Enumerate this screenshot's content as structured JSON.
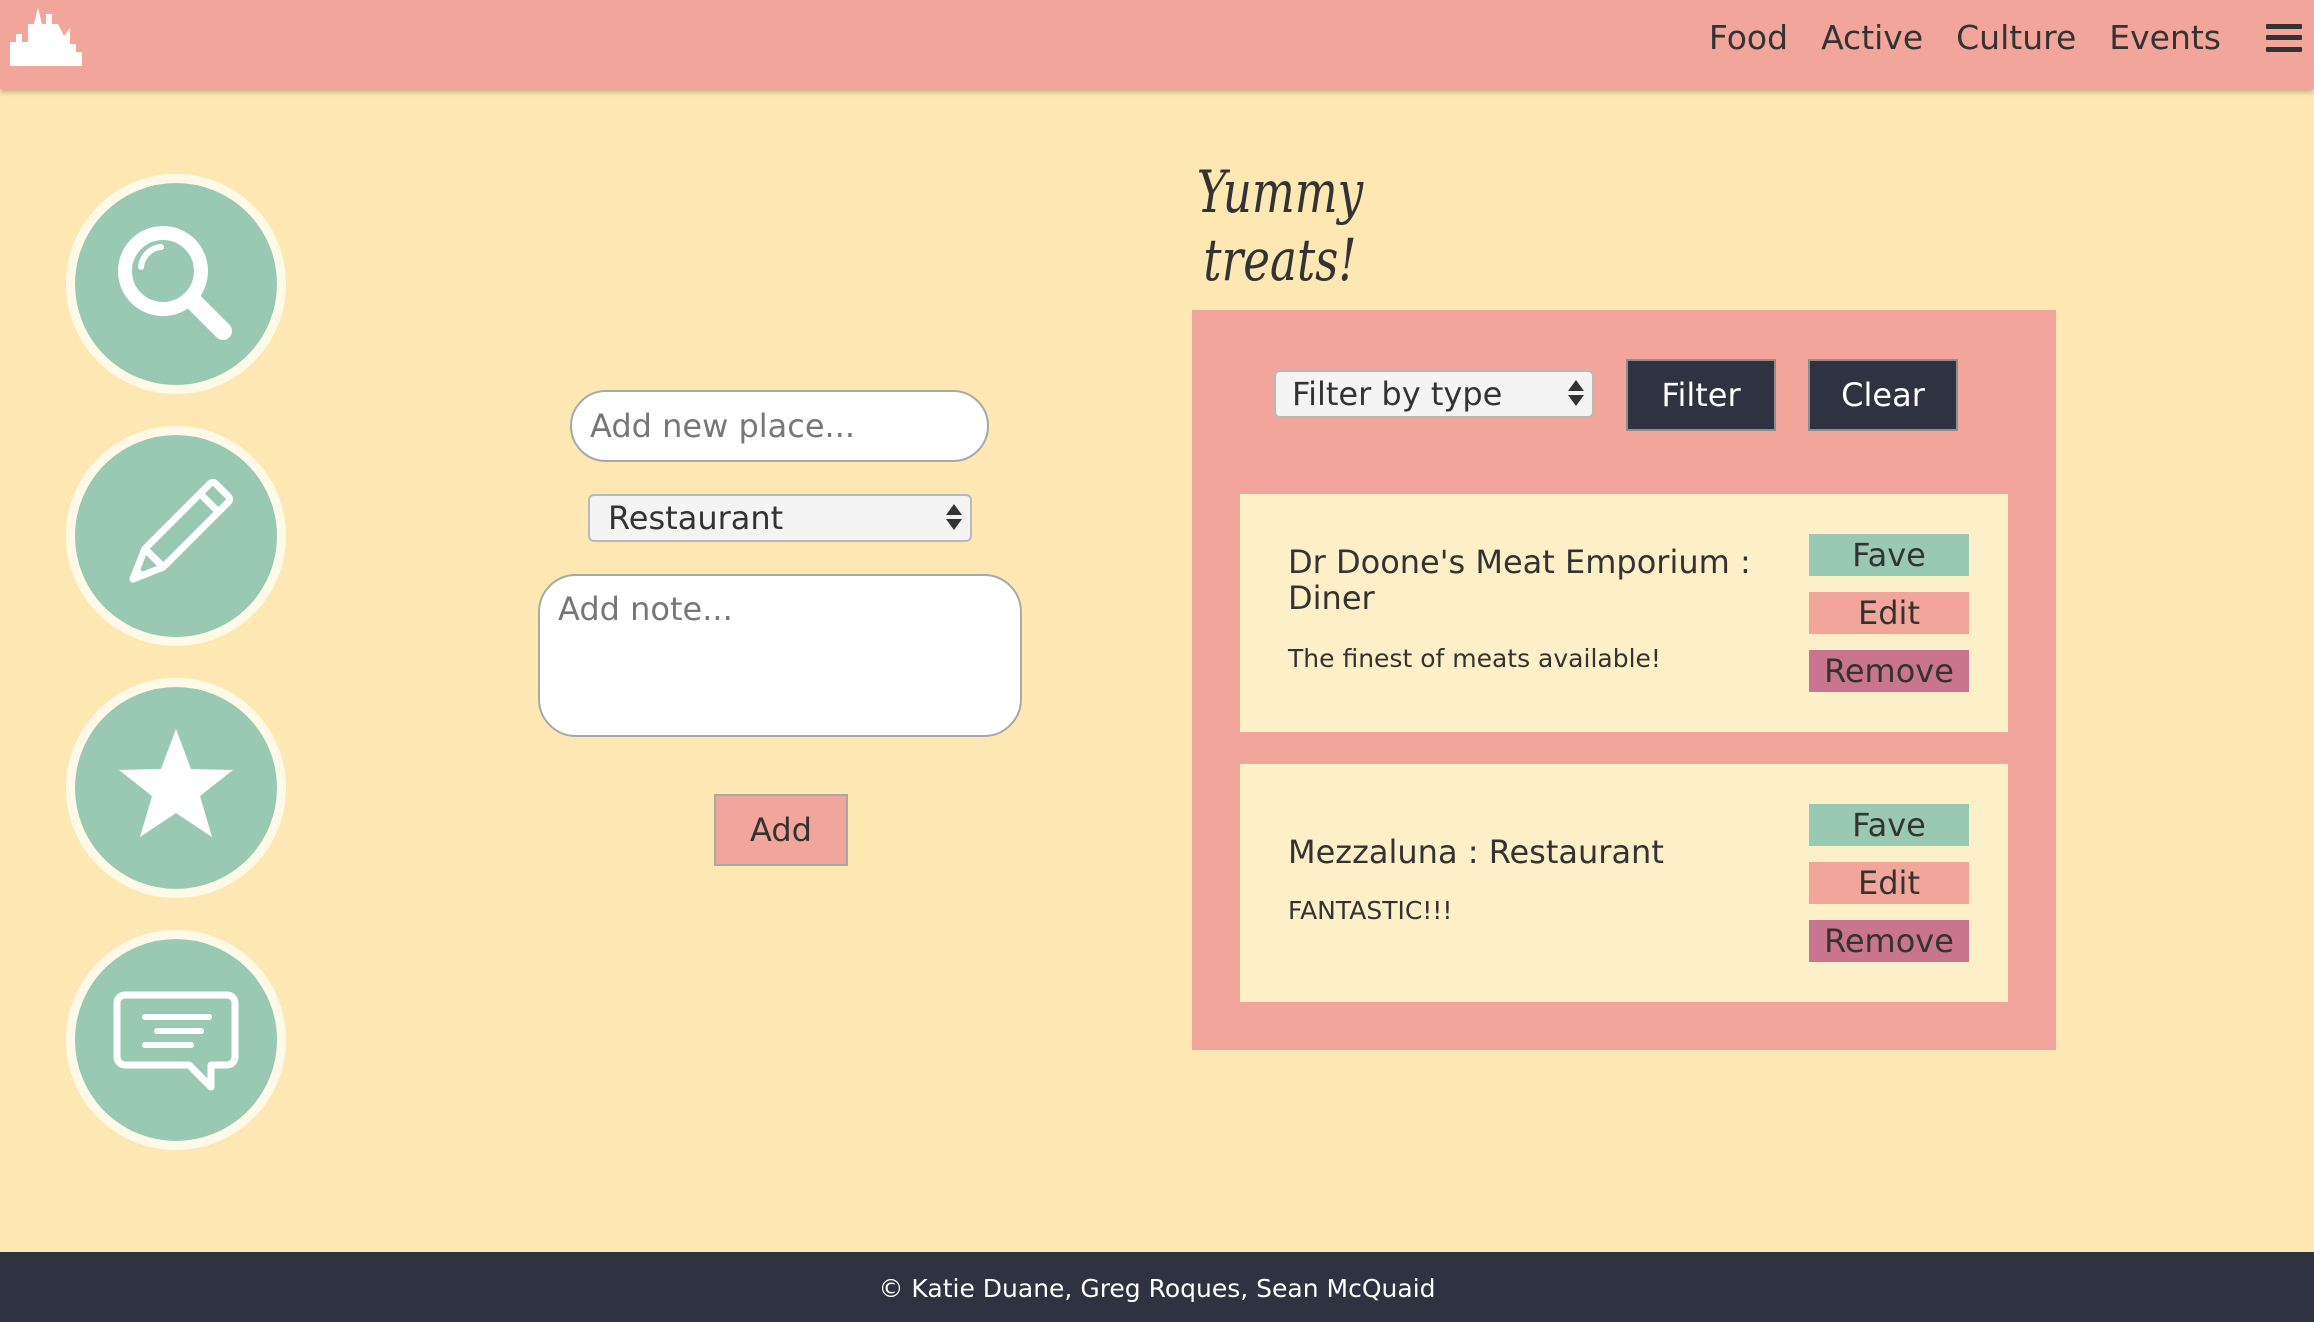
{
  "header": {
    "nav": [
      "Food",
      "Active",
      "Culture",
      "Events"
    ]
  },
  "sidebar": [
    {
      "icon": "search-icon"
    },
    {
      "icon": "pencil-icon"
    },
    {
      "icon": "star-icon"
    },
    {
      "icon": "comment-icon"
    }
  ],
  "page": {
    "title": "Yummy treats!"
  },
  "form": {
    "place_placeholder": "Add new place...",
    "type_selected": "Restaurant",
    "note_placeholder": "Add note...",
    "add_label": "Add"
  },
  "panel": {
    "filter_placeholder": "Filter by type",
    "filter_label": "Filter",
    "clear_label": "Clear",
    "places": [
      {
        "title": "Dr Doone's Meat Emporium : Diner",
        "note": "The finest of meats available!",
        "fave": "Fave",
        "edit": "Edit",
        "remove": "Remove"
      },
      {
        "title": "Mezzaluna : Restaurant",
        "note": "FANTASTIC!!!",
        "fave": "Fave",
        "edit": "Edit",
        "remove": "Remove"
      }
    ]
  },
  "footer": {
    "text": "© Katie Duane, Greg Roques, Sean McQuaid"
  },
  "colors": {
    "background": "#fde8b4",
    "header": "#f2a59a",
    "accent_green": "#99c9b3",
    "dark": "#2f3240",
    "remove": "#c97590"
  }
}
